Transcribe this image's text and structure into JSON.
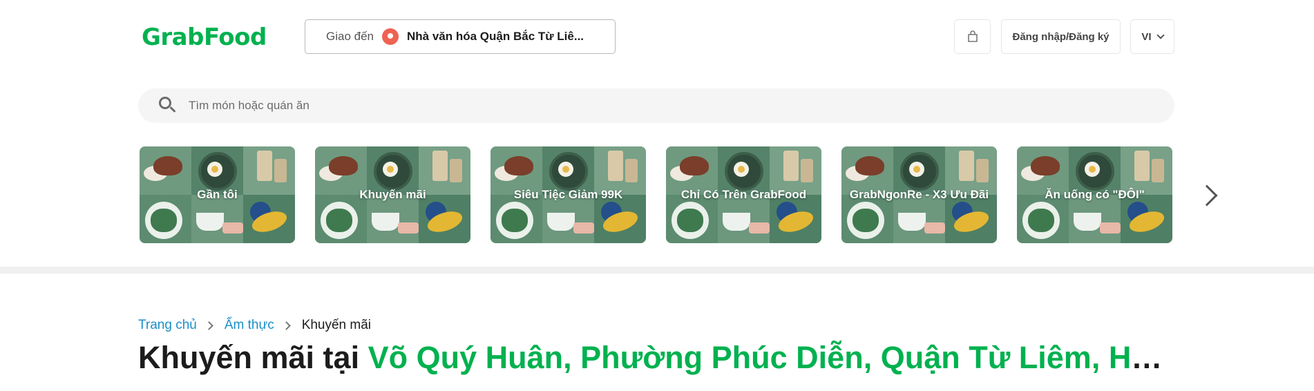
{
  "header": {
    "logo": "GrabFood",
    "deliver_label": "Giao đến",
    "address": "Nhà văn hóa Quận Bắc Từ Liê...",
    "login_label": "Đăng nhập/Đăng ký",
    "lang": "VI"
  },
  "search": {
    "placeholder": "Tìm món hoặc quán ăn"
  },
  "categories": [
    {
      "label": "Gần tôi"
    },
    {
      "label": "Khuyến mãi"
    },
    {
      "label": "Siêu Tiệc Giảm 99K"
    },
    {
      "label": "Chỉ Có Trên GrabFood"
    },
    {
      "label": "GrabNgonRe - X3 Ưu Đãi"
    },
    {
      "label": "Ăn uống có \"ĐÔI\""
    }
  ],
  "breadcrumb": {
    "home": "Trang chủ",
    "cuisine": "Ẩm thực",
    "current": "Khuyến mãi"
  },
  "title": {
    "prefix": "Khuyến mãi tại ",
    "location": "Võ Quý Huân, Phường Phúc Diễn, Quận Từ Liêm, Hà Nội"
  },
  "colors": {
    "brand": "#00b14f",
    "link": "#1a8fc9",
    "pin": "#ee6352"
  },
  "icons": {
    "cart": "shopping-bag-icon",
    "search": "search-icon",
    "location": "location-pin-icon",
    "next": "chevron-right-icon",
    "lang": "chevron-down-icon"
  }
}
